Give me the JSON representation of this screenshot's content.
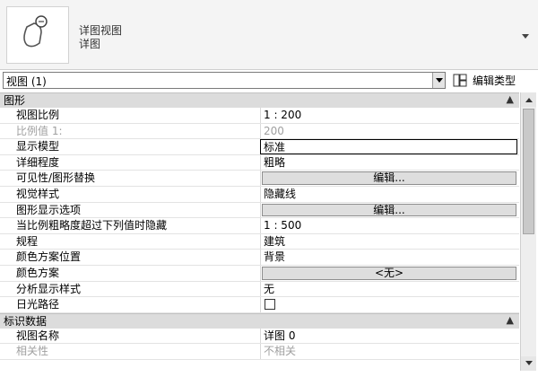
{
  "type_selector": {
    "family": "详图视图",
    "type": "详图"
  },
  "instance_selector": {
    "value": "视图 (1)"
  },
  "edit_type": {
    "label": "编辑类型"
  },
  "groups": {
    "graphics": {
      "label": "图形",
      "rows": [
        {
          "name": "视图比例",
          "value": "1 : 200"
        },
        {
          "name": "比例值 1:",
          "value": "200"
        },
        {
          "name": "显示模型",
          "value": "标准"
        },
        {
          "name": "详细程度",
          "value": "粗略"
        },
        {
          "name": "可见性/图形替换",
          "value": "编辑..."
        },
        {
          "name": "视觉样式",
          "value": "隐藏线"
        },
        {
          "name": "图形显示选项",
          "value": "编辑..."
        },
        {
          "name": "当比例粗略度超过下列值时隐藏",
          "value": "1 : 500"
        },
        {
          "name": "规程",
          "value": "建筑"
        },
        {
          "name": "颜色方案位置",
          "value": "背景"
        },
        {
          "name": "颜色方案",
          "value": "<无>"
        },
        {
          "name": "分析显示样式",
          "value": "无"
        },
        {
          "name": "日光路径",
          "value": ""
        }
      ]
    },
    "identity": {
      "label": "标识数据",
      "rows": [
        {
          "name": "视图名称",
          "value": "详图 0"
        },
        {
          "name": "相关性",
          "value": "不相关"
        }
      ]
    }
  }
}
